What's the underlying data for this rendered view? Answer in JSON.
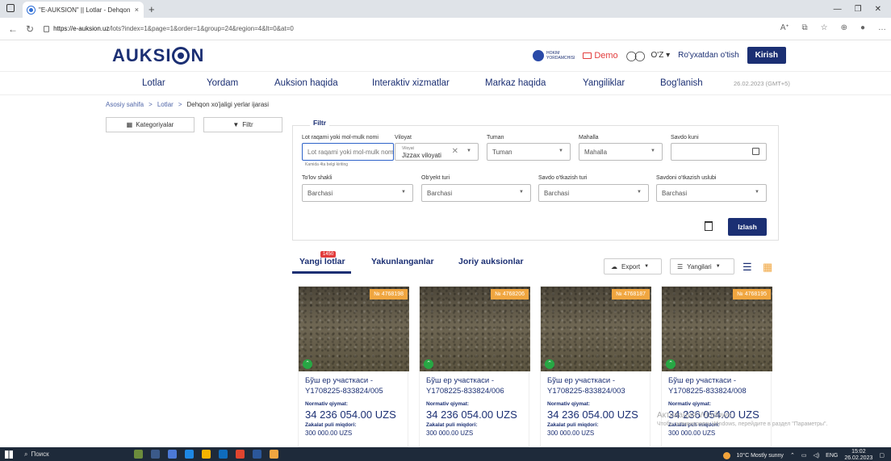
{
  "browser": {
    "tab_title": "\"E-AUKSION\" || Lotlar - Dehqon",
    "tab_close": "×",
    "new_tab": "+",
    "url_host": "https://e-auksion.uz",
    "url_path": "/lots?index=1&page=1&order=1&group=24&region=4&lt=0&at=0"
  },
  "header": {
    "logo_left": "AUKSI",
    "logo_right": "N",
    "hokim_top": "HOKIM",
    "hokim_bottom": "YORDAMCHISI",
    "demo": "Demo",
    "glasses": "◯◯",
    "lang": "O'Z ▾",
    "register": "Ro'yxatdan o'tish",
    "login": "Kirish"
  },
  "nav": {
    "items": [
      "Lotlar",
      "Yordam",
      "Auksion haqida",
      "Interaktiv xizmatlar",
      "Markaz haqida",
      "Yangiliklar",
      "Bog'lanish"
    ],
    "date": "26.02.2023 (GMT+5)"
  },
  "breadcrumb": {
    "home": "Asosiy sahifa",
    "sep": ">",
    "lots": "Lotlar",
    "current": "Dehqon xo'jaligi yerlar ijarasi"
  },
  "left": {
    "categories": "Kategoriyalar",
    "filter": "Filtr"
  },
  "filter": {
    "title": "Filtr",
    "lot_label": "Lot raqami yoki mol-mulk nomi",
    "lot_placeholder": "Lot raqami yoki mol-mulk nomi",
    "lot_hint": "Kamida 4ta belgi kiriting",
    "viloyat_label": "Viloyat",
    "viloyat_small": "Viloyat",
    "viloyat_value": "Jizzax viloyati",
    "tuman_label": "Tuman",
    "tuman_value": "Tuman",
    "mahalla_label": "Mahalla",
    "mahalla_value": "Mahalla",
    "savdo_kuni_label": "Savdo kuni",
    "tolov_label": "To'lov shakli",
    "tolov_value": "Barchasi",
    "obyekt_label": "Ob'yekt turi",
    "obyekt_value": "Barchasi",
    "otkazish_label": "Savdo o'tkazish turi",
    "otkazish_value": "Barchasi",
    "uslubi_label": "Savdoni o'tkazish uslubi",
    "uslubi_value": "Barchasi",
    "search": "Izlash"
  },
  "tabs": {
    "new": "Yangi lotlar",
    "badge": "1450",
    "finished": "Yakunlanganlar",
    "current": "Joriy auksionlar",
    "export": "Export",
    "sort": "Yangilari"
  },
  "cards": [
    {
      "num": "№ 4768198",
      "name": "Бўш ер участкаси - Y1708225-833824/005",
      "nlab": "Normativ qiymat:",
      "nval": "34 236 054.00 UZS",
      "zlab": "Zakalat puli miqdori:",
      "zval": "300 000.00 UZS"
    },
    {
      "num": "№ 4768206",
      "name": "Бўш ер участкаси - Y1708225-833824/006",
      "nlab": "Normativ qiymat:",
      "nval": "34 236 054.00 UZS",
      "zlab": "Zakalat puli miqdori:",
      "zval": "300 000.00 UZS"
    },
    {
      "num": "№ 4768187",
      "name": "Бўш ер участкаси - Y1708225-833824/003",
      "nlab": "Normativ qiymat:",
      "nval": "34 236 054.00 UZS",
      "zlab": "Zakalat puli miqdori:",
      "zval": "300 000.00 UZS"
    },
    {
      "num": "№ 4768195",
      "name": "Бўш ер участкаси - Y1708225-833824/008",
      "nlab": "Normativ qiymat:",
      "nval": "34 236 054.00 UZS",
      "zlab": "Zakalat puli miqdori:",
      "zval": "300 000.00 UZS"
    }
  ],
  "watermark": {
    "line1": "Активация Windows",
    "line2": "Чтобы активировать Windows, перейдите в раздел \"Параметры\"."
  },
  "taskbar": {
    "search": "Поиск",
    "weather": "10°C  Mostly sunny",
    "lang": "ENG",
    "time": "15:02",
    "date": "26.02.2023"
  },
  "colors": {
    "brand": "#1b2f73",
    "accent": "#e23c3c",
    "badge_orange": "#f0a640",
    "status_green": "#27a744"
  }
}
